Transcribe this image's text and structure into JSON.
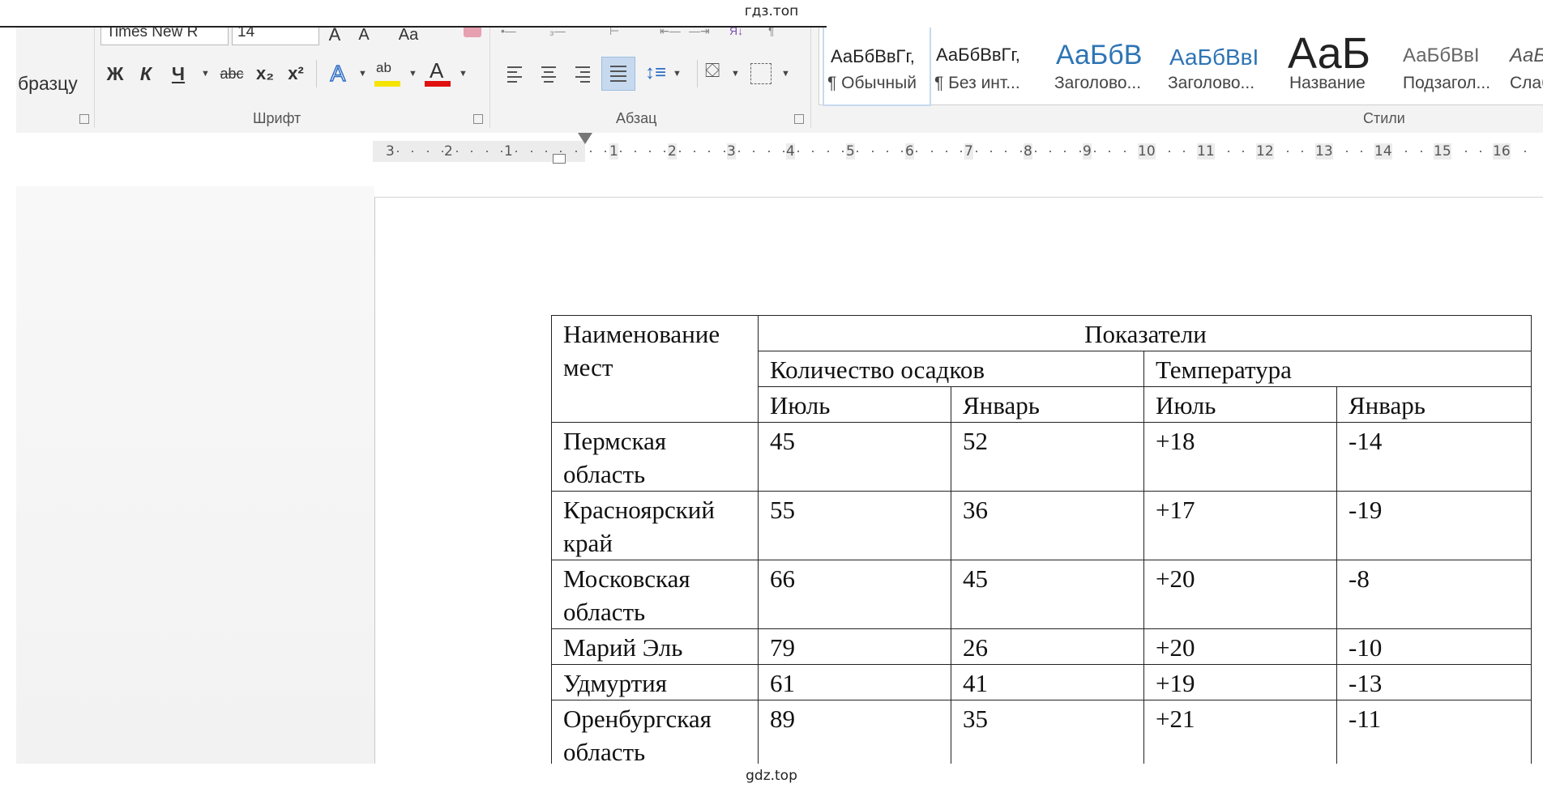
{
  "watermark": {
    "top": "гдз.топ",
    "bottom": "gdz.top"
  },
  "ribbon": {
    "partial_left_label": "бразцу",
    "font": {
      "group_label": "Шрифт",
      "font_name": "Times New R",
      "font_size": "14",
      "grow_font": "A",
      "shrink_font": "A",
      "change_case": "Aa",
      "bold": "Ж",
      "italic": "К",
      "underline": "Ч",
      "strikethrough": "abc",
      "subscript": "x₂",
      "superscript": "x²",
      "text_effects": "A",
      "highlight": "ab",
      "font_color": "A",
      "highlight_color": "#f5e400",
      "font_color_value": "#e01010"
    },
    "paragraph": {
      "group_label": "Абзац"
    },
    "styles": {
      "group_label": "Стили",
      "items": [
        {
          "sample": "АаБбВвГг,",
          "name": "¶ Обычный",
          "selected": true
        },
        {
          "sample": "АаБбВвГг,",
          "name": "¶ Без инт..."
        },
        {
          "sample": "АаБбВ",
          "name": "Заголово..."
        },
        {
          "sample": "АаБбВвI",
          "name": "Заголово..."
        },
        {
          "sample": "АаБ",
          "name": "Название"
        },
        {
          "sample": "АаБбВвI",
          "name": "Подзагол..."
        },
        {
          "sample": "АаБ",
          "name": "Слаб"
        }
      ]
    }
  },
  "ruler": {
    "left_numbers": [
      "3",
      "2",
      "1"
    ],
    "right_numbers": [
      "1",
      "2",
      "3",
      "4",
      "5",
      "6",
      "7",
      "8",
      "9",
      "10",
      "11",
      "12",
      "13",
      "14",
      "15",
      "16"
    ]
  },
  "table": {
    "header": {
      "name_col": "Наименование мест",
      "indicators": "Показатели",
      "precip": "Количество осадков",
      "temp": "Температура",
      "july": "Июль",
      "january": "Январь"
    },
    "rows": [
      {
        "name": "Пермская область",
        "precip_july": "45",
        "precip_jan": "52",
        "temp_july": "+18",
        "temp_jan": "-14"
      },
      {
        "name": "Красноярский край",
        "precip_july": "55",
        "precip_jan": "36",
        "temp_july": "+17",
        "temp_jan": "-19"
      },
      {
        "name": "Московская область",
        "precip_july": "66",
        "precip_jan": "45",
        "temp_july": "+20",
        "temp_jan": "-8"
      },
      {
        "name": "Марий Эль",
        "precip_july": "79",
        "precip_jan": "26",
        "temp_july": "+20",
        "temp_jan": "-10"
      },
      {
        "name": "Удмуртия",
        "precip_july": "61",
        "precip_jan": "41",
        "temp_july": "+19",
        "temp_jan": "-13"
      },
      {
        "name": "Оренбургская область",
        "precip_july": "89",
        "precip_jan": "35",
        "temp_july": "+21",
        "temp_jan": "-11"
      }
    ]
  }
}
